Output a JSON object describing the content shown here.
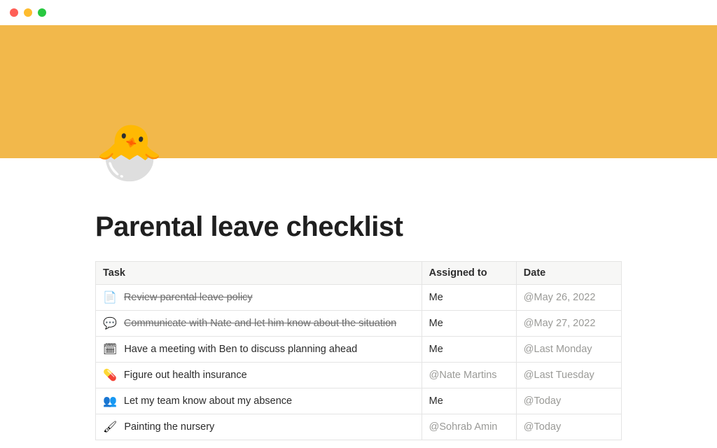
{
  "window": {
    "close_label": "close",
    "minimize_label": "minimize",
    "zoom_label": "zoom"
  },
  "page": {
    "icon": "🐣",
    "title": "Parental leave checklist"
  },
  "columns": {
    "task": "Task",
    "assigned": "Assigned to",
    "date": "Date"
  },
  "rows": [
    {
      "emoji": "📄",
      "task": "Review parental leave policy",
      "struck": true,
      "assigned_text": "Me",
      "assigned_is_mention": false,
      "date": "@May 26, 2022"
    },
    {
      "emoji": "💬",
      "task": "Communicate with Nate and let him know about the situation",
      "struck": true,
      "assigned_text": "Me",
      "assigned_is_mention": false,
      "date": "@May 27, 2022"
    },
    {
      "emoji": "🗓",
      "task": "Have a meeting with Ben to discuss planning ahead",
      "struck": false,
      "assigned_text": "Me",
      "assigned_is_mention": false,
      "date": "@Last Monday"
    },
    {
      "emoji": "💊",
      "task": "Figure out health insurance",
      "struck": false,
      "assigned_text": "@Nate Martins",
      "assigned_is_mention": true,
      "date": "@Last Tuesday"
    },
    {
      "emoji": "👥",
      "task": "Let my team know about my absence",
      "struck": false,
      "assigned_text": "Me",
      "assigned_is_mention": false,
      "date": "@Today"
    },
    {
      "emoji": "🖌",
      "task": "Painting the nursery",
      "struck": false,
      "assigned_text": "@Sohrab Amin",
      "assigned_is_mention": true,
      "date": "@Today"
    }
  ],
  "colors": {
    "cover": "#f2b84b",
    "border": "#e4e4e4",
    "header_bg": "#f7f7f6",
    "muted": "#9a9a97",
    "text": "#2b2b2b"
  }
}
